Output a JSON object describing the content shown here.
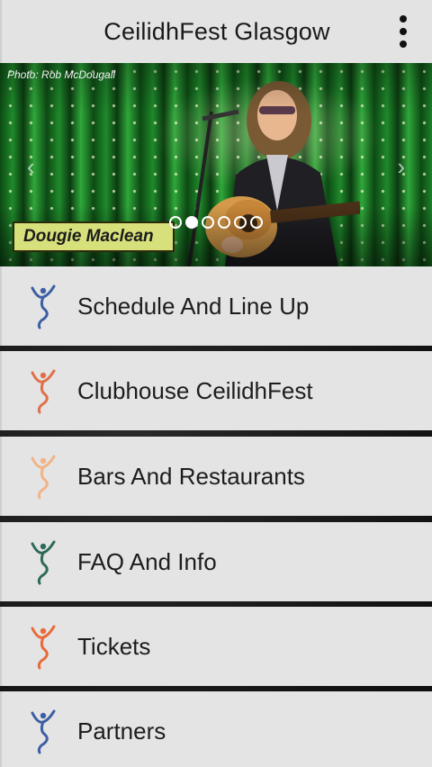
{
  "header": {
    "title": "CeilidhFest Glasgow",
    "menu_icon": "vertical-ellipsis-icon"
  },
  "carousel": {
    "photo_credit": "Photo: Rob McDougall",
    "caption": "Dougie Maclean",
    "prev_icon": "chevron-left-icon",
    "next_icon": "chevron-right-icon",
    "slide_count": 6,
    "active_slide": 2
  },
  "menu": {
    "items": [
      {
        "label": "Schedule And Line Up",
        "icon": "dancer-icon",
        "icon_color": "#3d5fa3"
      },
      {
        "label": "Clubhouse CeilidhFest",
        "icon": "dancer-icon",
        "icon_color": "#e0704a"
      },
      {
        "label": "Bars And Restaurants",
        "icon": "dancer-icon",
        "icon_color": "#f0b488"
      },
      {
        "label": "FAQ And Info",
        "icon": "dancer-icon",
        "icon_color": "#2f6a5a"
      },
      {
        "label": "Tickets",
        "icon": "dancer-icon",
        "icon_color": "#e86a3a"
      },
      {
        "label": "Partners",
        "icon": "dancer-icon",
        "icon_color": "#3d5fa3"
      }
    ]
  }
}
